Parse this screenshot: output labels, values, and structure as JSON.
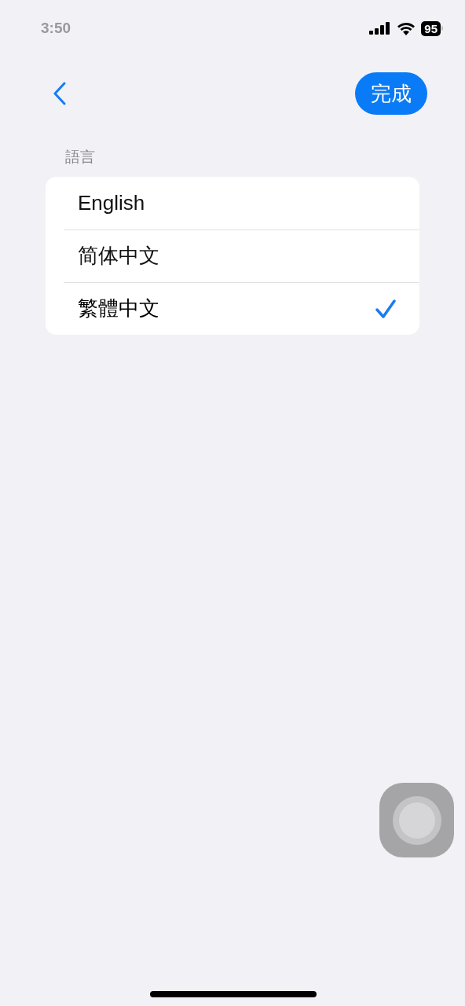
{
  "status_bar": {
    "time": "3:50",
    "battery": "95"
  },
  "nav": {
    "done": "完成"
  },
  "section": {
    "header": "語言",
    "options": [
      {
        "label": "English",
        "selected": false
      },
      {
        "label": "简体中文",
        "selected": false
      },
      {
        "label": "繁體中文",
        "selected": true
      }
    ]
  }
}
